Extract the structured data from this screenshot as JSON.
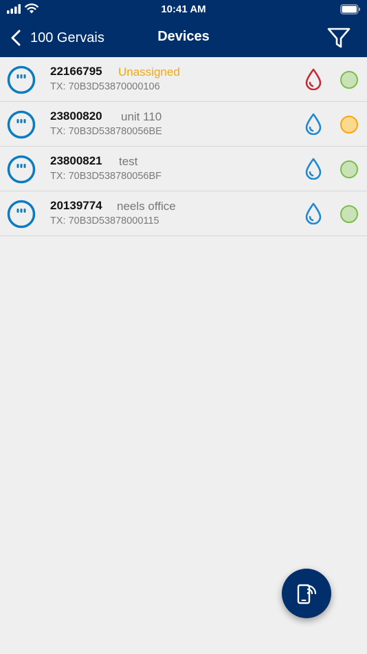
{
  "status_bar": {
    "time": "10:41 AM"
  },
  "nav": {
    "back_label": "100 Gervais",
    "title": "Devices"
  },
  "colors": {
    "navy": "#002f6c",
    "meter_blue": "#0b7cc1",
    "drop_blue": "#1e88d1",
    "drop_red": "#c62c36",
    "ok_green_fill": "#c9e3b6",
    "ok_green_border": "#7cbc4b",
    "warn_amber_fill": "#fbd98f",
    "warn_amber_border": "#f5a70e",
    "unassigned_text": "#f5a70e"
  },
  "devices": [
    {
      "number": "22166795",
      "name": "Unassigned",
      "tx": "TX: 70B3D53870000106",
      "drop": "red",
      "status": "green",
      "name_style": "warn"
    },
    {
      "number": "23800820",
      "name": "unit 110",
      "tx": "TX: 70B3D538780056BE",
      "drop": "blue",
      "status": "amber",
      "name_style": "normal"
    },
    {
      "number": "23800821",
      "name": "test",
      "tx": "TX: 70B3D538780056BF",
      "drop": "blue",
      "status": "green",
      "name_style": "normal"
    },
    {
      "number": "20139774",
      "name": "neels office",
      "tx": "TX: 70B3D53878000115",
      "drop": "blue",
      "status": "green",
      "name_style": "normal"
    }
  ],
  "icons": {
    "back": "chevron-left-icon",
    "filter": "filter-icon",
    "meter": "meter-icon",
    "drop": "water-drop-icon",
    "status": "status-dot-icon",
    "fab": "phone-nfc-icon"
  }
}
